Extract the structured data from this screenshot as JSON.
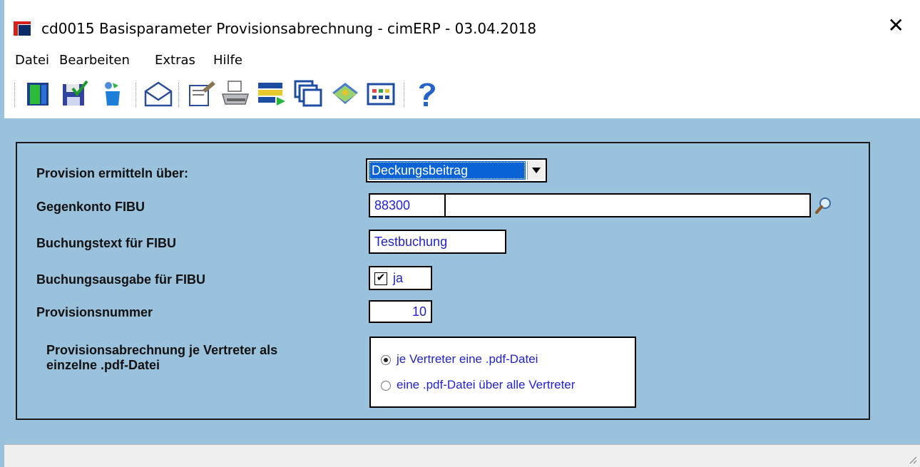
{
  "window": {
    "title": "cd0015 Basisparameter Provisionsabrechnung - cimERP - 03.04.2018",
    "close_icon": "close-icon"
  },
  "menu": {
    "items": [
      "Datei",
      "Bearbeiten",
      "Extras",
      "Hilfe"
    ]
  },
  "toolbar": {
    "icons": [
      "exit-door-icon",
      "save-icon",
      "refresh-icon",
      "envelope-icon",
      "document-edit-icon",
      "printer-icon",
      "export-icon",
      "windows-icon",
      "book-icon",
      "calculator-icon",
      "help-icon"
    ]
  },
  "form": {
    "provision_label": "Provision ermitteln über:",
    "provision_value": "Deckungsbeitrag",
    "gegenkonto_label": "Gegenkonto FIBU",
    "gegenkonto_value": "88300",
    "gegenkonto_name": "",
    "buchungstext_label": "Buchungstext für FIBU",
    "buchungstext_value": "Testbuchung",
    "buchungsausgabe_label": "Buchungsausgabe für FIBU",
    "buchungsausgabe_checked": true,
    "buchungsausgabe_text": "ja",
    "provisionsnummer_label": "Provisionsnummer",
    "provisionsnummer_value": "10",
    "pdf_label_line1": "Provisionsabrechnung je Vertreter als",
    "pdf_label_line2": "einzelne .pdf-Datei",
    "pdf_options": [
      {
        "label": "je Vertreter eine .pdf-Datei",
        "selected": true
      },
      {
        "label": "eine .pdf-Datei über alle Vertreter",
        "selected": false
      }
    ]
  },
  "colors": {
    "client_bg": "#9bc2dd",
    "field_text": "#2222cc",
    "selection": "#0a64d8"
  }
}
